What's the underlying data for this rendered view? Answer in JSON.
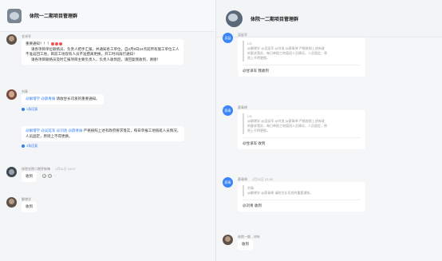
{
  "left": {
    "header": {
      "title": "体院一二期项目管理群"
    },
    "msgs": [
      {
        "sender": "甘泽军",
        "title_prefix": "重要通知",
        "title_marks": "！！！",
        "lines": [
          "请各项目单位联络员、负责人把手汇报，并通知各工单位，自2月9日24点前所有施工单位工人",
          "不准返回工地，目前工地现有人员不准擅离更换，开工时间再行通知！",
          "请各项目联络员及时汇报项目主要负责人，负责人收到后，请回复我收到，谢谢！"
        ]
      },
      {
        "sender": "刘青",
        "mentions": "@解增学 @薛青倬",
        "text": "请收甘长司发的重要通知。",
        "replies": "1条回复"
      },
      {
        "mentions": "@解增学 @吴延军 @刘池 @薛青倬",
        "text1": "严格按照上述有政府要求落实，每日单报工地值班人员情况，",
        "text2": "人员固定，原则上不得更换。",
        "replies": "3条回复"
      },
      {
        "sender": "体院光院二期罗新锋",
        "time": "1月31日 10:07",
        "text": "收到"
      },
      {
        "sender": "解增学",
        "text": "收到"
      }
    ]
  },
  "right": {
    "header": {
      "title": "体院一二期项目管理群",
      "badge": "群"
    },
    "msgs": [
      {
        "sender": "吴延军",
        "avatar": "吴延",
        "quote_head": "LG:",
        "quote_mentions": "@解增学 @吴延军 @刘池 @薛青倬",
        "quote1": "严格按照上述有政",
        "quote2": "府要求落实，每日单报工地值班人员情况，人员固定，原",
        "quote3": "则上不得更换。",
        "reply": "@甘泽军 我收到"
      },
      {
        "sender": "薛青倬",
        "avatar": "薛青",
        "quote_head": "LG:",
        "quote_mentions": "@解增学 @吴延军 @刘池 @薛青倬",
        "quote1": "严格按照上述有政",
        "quote2": "府要求落实，每日单报工地值班人员情况，人员固定，原",
        "quote3": "则上不得更换。",
        "reply": "@甘泽军 收到"
      },
      {
        "sender": "薛青倬",
        "avatar": "薛青",
        "time": "1月31日 12:48",
        "quote_head": "刘青:",
        "quote_mentions": "@解增学 @薛青倬",
        "quote1": "请收甘长司发的重要通知。",
        "reply": "@刘青 收到"
      },
      {
        "sender": "体院一期 - 刘炜",
        "text": "收到"
      }
    ]
  },
  "icons": {
    "emoji": "alarm-emoji",
    "reply": "reply-dot-icon",
    "more": "more-icon"
  }
}
